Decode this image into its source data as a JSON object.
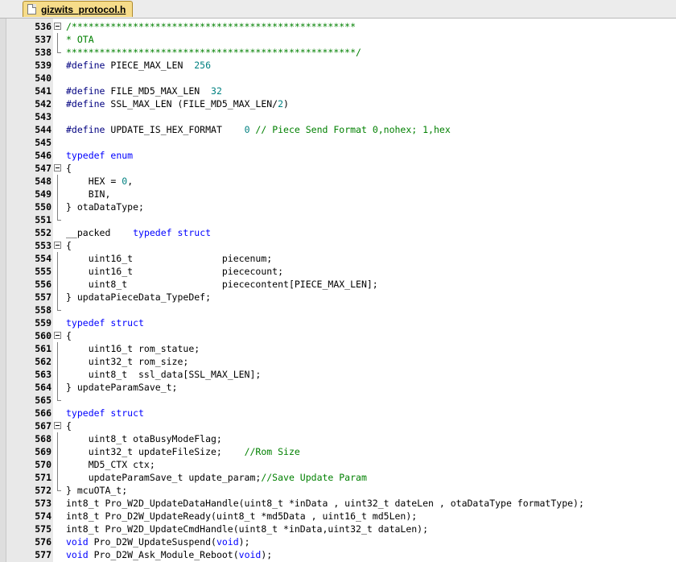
{
  "tab": {
    "title": "gizwits_protocol.h"
  },
  "lines": [
    {
      "n": "536",
      "fold": "box",
      "tokens": [
        {
          "t": "cm",
          "v": "/***************************************************"
        }
      ]
    },
    {
      "n": "537",
      "fold": "vline",
      "tokens": [
        {
          "t": "cm",
          "v": "* OTA"
        }
      ]
    },
    {
      "n": "538",
      "fold": "end",
      "tokens": [
        {
          "t": "cm",
          "v": "****************************************************/"
        }
      ]
    },
    {
      "n": "539",
      "fold": "",
      "tokens": [
        {
          "t": "pp",
          "v": "#define"
        },
        {
          "t": "p",
          "v": " PIECE_MAX_LEN  "
        },
        {
          "t": "num",
          "v": "256"
        }
      ]
    },
    {
      "n": "540",
      "fold": "",
      "tokens": []
    },
    {
      "n": "541",
      "fold": "",
      "tokens": [
        {
          "t": "pp",
          "v": "#define"
        },
        {
          "t": "p",
          "v": " FILE_MD5_MAX_LEN  "
        },
        {
          "t": "num",
          "v": "32"
        }
      ]
    },
    {
      "n": "542",
      "fold": "",
      "tokens": [
        {
          "t": "pp",
          "v": "#define"
        },
        {
          "t": "p",
          "v": " SSL_MAX_LEN (FILE_MD5_MAX_LEN/"
        },
        {
          "t": "num",
          "v": "2"
        },
        {
          "t": "p",
          "v": ")"
        }
      ]
    },
    {
      "n": "543",
      "fold": "",
      "tokens": []
    },
    {
      "n": "544",
      "fold": "",
      "tokens": [
        {
          "t": "pp",
          "v": "#define"
        },
        {
          "t": "p",
          "v": " UPDATE_IS_HEX_FORMAT    "
        },
        {
          "t": "num",
          "v": "0"
        },
        {
          "t": "cm",
          "v": " // Piece Send Format 0,nohex; 1,hex"
        }
      ]
    },
    {
      "n": "545",
      "fold": "",
      "tokens": []
    },
    {
      "n": "546",
      "fold": "",
      "tokens": [
        {
          "t": "kw",
          "v": "typedef"
        },
        {
          "t": "p",
          "v": " "
        },
        {
          "t": "kw",
          "v": "enum"
        }
      ]
    },
    {
      "n": "547",
      "fold": "box",
      "tokens": [
        {
          "t": "p",
          "v": "{"
        }
      ]
    },
    {
      "n": "548",
      "fold": "vline",
      "tokens": [
        {
          "t": "p",
          "v": "    HEX = "
        },
        {
          "t": "num",
          "v": "0"
        },
        {
          "t": "p",
          "v": ","
        }
      ]
    },
    {
      "n": "549",
      "fold": "vline",
      "tokens": [
        {
          "t": "p",
          "v": "    BIN,"
        }
      ]
    },
    {
      "n": "550",
      "fold": "vline",
      "tokens": [
        {
          "t": "p",
          "v": "} otaDataType;"
        }
      ]
    },
    {
      "n": "551",
      "fold": "end",
      "tokens": []
    },
    {
      "n": "552",
      "fold": "",
      "tokens": [
        {
          "t": "p",
          "v": "__packed    "
        },
        {
          "t": "kw",
          "v": "typedef"
        },
        {
          "t": "p",
          "v": " "
        },
        {
          "t": "kw",
          "v": "struct"
        }
      ]
    },
    {
      "n": "553",
      "fold": "box",
      "tokens": [
        {
          "t": "p",
          "v": "{"
        }
      ]
    },
    {
      "n": "554",
      "fold": "vline",
      "tokens": [
        {
          "t": "p",
          "v": "    uint16_t                piecenum;"
        }
      ]
    },
    {
      "n": "555",
      "fold": "vline",
      "tokens": [
        {
          "t": "p",
          "v": "    uint16_t                piececount;"
        }
      ]
    },
    {
      "n": "556",
      "fold": "vline",
      "tokens": [
        {
          "t": "p",
          "v": "    uint8_t                 piececontent[PIECE_MAX_LEN];"
        }
      ]
    },
    {
      "n": "557",
      "fold": "vline",
      "tokens": [
        {
          "t": "p",
          "v": "} updataPieceData_TypeDef;"
        }
      ]
    },
    {
      "n": "558",
      "fold": "end",
      "tokens": []
    },
    {
      "n": "559",
      "fold": "",
      "tokens": [
        {
          "t": "kw",
          "v": "typedef"
        },
        {
          "t": "p",
          "v": " "
        },
        {
          "t": "kw",
          "v": "struct"
        }
      ]
    },
    {
      "n": "560",
      "fold": "box",
      "tokens": [
        {
          "t": "p",
          "v": "{"
        }
      ]
    },
    {
      "n": "561",
      "fold": "vline",
      "tokens": [
        {
          "t": "p",
          "v": "    uint16_t rom_statue;"
        }
      ]
    },
    {
      "n": "562",
      "fold": "vline",
      "tokens": [
        {
          "t": "p",
          "v": "    uint32_t rom_size;"
        }
      ]
    },
    {
      "n": "563",
      "fold": "vline",
      "tokens": [
        {
          "t": "p",
          "v": "    uint8_t  ssl_data[SSL_MAX_LEN];"
        }
      ]
    },
    {
      "n": "564",
      "fold": "vline",
      "tokens": [
        {
          "t": "p",
          "v": "} updateParamSave_t;"
        }
      ]
    },
    {
      "n": "565",
      "fold": "end",
      "tokens": []
    },
    {
      "n": "566",
      "fold": "",
      "tokens": [
        {
          "t": "kw",
          "v": "typedef"
        },
        {
          "t": "p",
          "v": " "
        },
        {
          "t": "kw",
          "v": "struct"
        }
      ]
    },
    {
      "n": "567",
      "fold": "box",
      "tokens": [
        {
          "t": "p",
          "v": "{"
        }
      ]
    },
    {
      "n": "568",
      "fold": "vline",
      "tokens": [
        {
          "t": "p",
          "v": "    uint8_t otaBusyModeFlag;"
        }
      ]
    },
    {
      "n": "569",
      "fold": "vline",
      "tokens": [
        {
          "t": "p",
          "v": "    uint32_t updateFileSize;    "
        },
        {
          "t": "cm",
          "v": "//Rom Size"
        }
      ]
    },
    {
      "n": "570",
      "fold": "vline",
      "tokens": [
        {
          "t": "p",
          "v": "    MD5_CTX ctx;"
        }
      ]
    },
    {
      "n": "571",
      "fold": "vline",
      "tokens": [
        {
          "t": "p",
          "v": "    updateParamSave_t update_param;"
        },
        {
          "t": "cm",
          "v": "//Save Update Param"
        }
      ]
    },
    {
      "n": "572",
      "fold": "end",
      "tokens": [
        {
          "t": "p",
          "v": "} mcuOTA_t;"
        }
      ]
    },
    {
      "n": "573",
      "fold": "",
      "tokens": [
        {
          "t": "p",
          "v": "int8_t Pro_W2D_UpdateDataHandle(uint8_t *inData , uint32_t dateLen , otaDataType formatType);"
        }
      ]
    },
    {
      "n": "574",
      "fold": "",
      "tokens": [
        {
          "t": "p",
          "v": "int8_t Pro_D2W_UpdateReady(uint8_t *md5Data , uint16_t md5Len);"
        }
      ]
    },
    {
      "n": "575",
      "fold": "",
      "tokens": [
        {
          "t": "p",
          "v": "int8_t Pro_W2D_UpdateCmdHandle(uint8_t *inData,uint32_t dataLen);"
        }
      ]
    },
    {
      "n": "576",
      "fold": "",
      "tokens": [
        {
          "t": "kw",
          "v": "void"
        },
        {
          "t": "p",
          "v": " Pro_D2W_UpdateSuspend("
        },
        {
          "t": "kw",
          "v": "void"
        },
        {
          "t": "p",
          "v": ");"
        }
      ]
    },
    {
      "n": "577",
      "fold": "",
      "tokens": [
        {
          "t": "kw",
          "v": "void"
        },
        {
          "t": "p",
          "v": " Pro_D2W_Ask_Module_Reboot("
        },
        {
          "t": "kw",
          "v": "void"
        },
        {
          "t": "p",
          "v": ");"
        }
      ]
    }
  ]
}
